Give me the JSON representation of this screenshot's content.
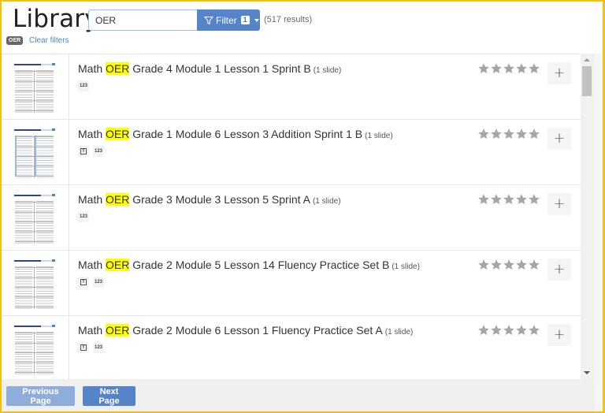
{
  "header": {
    "title": "Library",
    "search": {
      "value": "OER",
      "placeholder": ""
    },
    "filter_button": {
      "label": "Filter",
      "count": "1"
    },
    "results_count": "(517 results)",
    "active_filter_tag": "OER",
    "clear_filters_label": "Clear filters"
  },
  "items": [
    {
      "prefix": "Math ",
      "highlight": "OER",
      "suffix": " Grade 4 Module 1 Lesson 1 Sprint B",
      "slide_count": "(1 slide)",
      "tags": [
        "123"
      ],
      "rating": 0,
      "max_rating": 5
    },
    {
      "prefix": "Math ",
      "highlight": "OER",
      "suffix": " Grade 1 Module 6 Lesson 3 Addition Sprint 1 B",
      "slide_count": "(1 slide)",
      "tags": [
        "T",
        "123"
      ],
      "rating": 0,
      "max_rating": 5
    },
    {
      "prefix": "Math ",
      "highlight": "OER",
      "suffix": " Grade 3 Module 3 Lesson 5 Sprint A",
      "slide_count": "(1 slide)",
      "tags": [
        "123"
      ],
      "rating": 0,
      "max_rating": 5
    },
    {
      "prefix": "Math ",
      "highlight": "OER",
      "suffix": " Grade 2 Module 5 Lesson 14 Fluency Practice Set B",
      "slide_count": "(1 slide)",
      "tags": [
        "T",
        "123"
      ],
      "rating": 0,
      "max_rating": 5
    },
    {
      "prefix": "Math ",
      "highlight": "OER",
      "suffix": " Grade 2 Module 6 Lesson 1 Fluency Practice Set A",
      "slide_count": "(1 slide)",
      "tags": [
        "T",
        "123"
      ],
      "rating": 0,
      "max_rating": 5
    }
  ],
  "add_button_label": "+",
  "footer": {
    "previous_label": "Previous Page",
    "next_label": "Next Page"
  },
  "icons": {
    "filter": "funnel-icon",
    "star": "star-icon",
    "text_tag": "text-icon",
    "number_tag": "number-icon"
  },
  "colors": {
    "accent": "#5584c9",
    "accent_disabled": "#8eadda",
    "highlight": "#ffff00",
    "frame": "#f4c20d",
    "star": "#a6a6a6"
  }
}
